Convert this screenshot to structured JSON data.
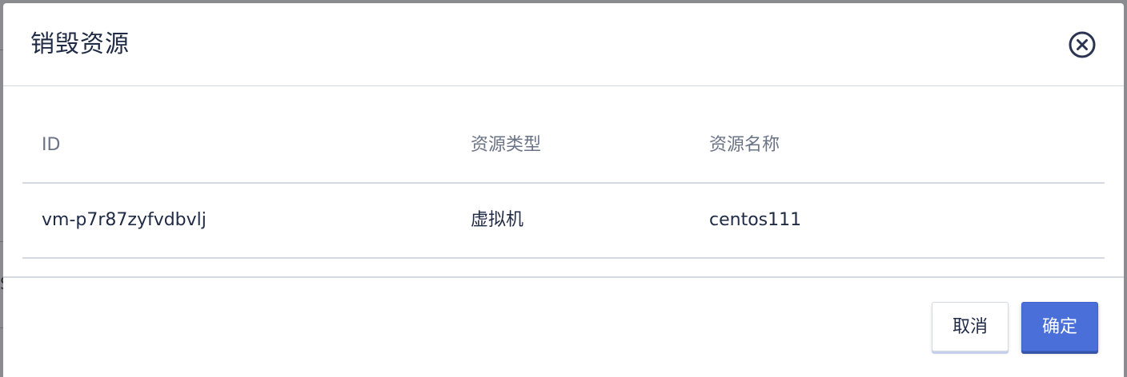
{
  "dialog": {
    "title": "销毁资源",
    "close_icon": "close-circle-icon"
  },
  "table": {
    "columns": [
      "ID",
      "资源类型",
      "资源名称"
    ],
    "rows": [
      {
        "id": "vm-p7r87zyfvdbvlj",
        "type": "虚拟机",
        "name": "centos111"
      }
    ]
  },
  "footer": {
    "cancel_label": "取消",
    "ok_label": "确定"
  },
  "colors": {
    "primary": "#4a6fd8",
    "title_text": "#1f2a44",
    "header_text": "#6b7386",
    "divider": "#d5d9e2"
  }
}
